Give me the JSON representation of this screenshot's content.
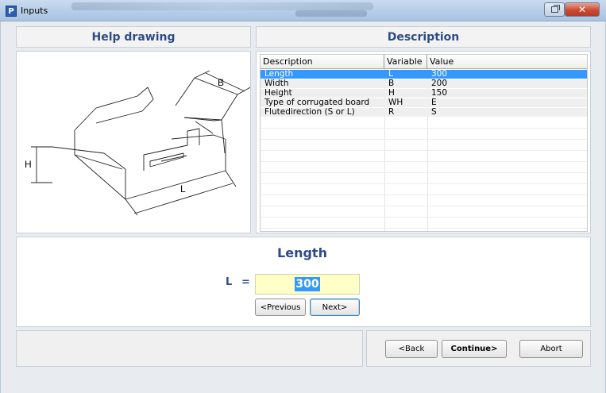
{
  "window": {
    "title": "Inputs",
    "app_icon_letter": "P"
  },
  "headers": {
    "help_drawing": "Help drawing",
    "description": "Description"
  },
  "drawing": {
    "label_b": "B",
    "label_h": "H",
    "label_l": "L"
  },
  "table": {
    "columns": [
      "Description",
      "Variable",
      "Value"
    ],
    "rows": [
      {
        "description": "Length",
        "variable": "L",
        "value": "300"
      },
      {
        "description": "Width",
        "variable": "B",
        "value": "200"
      },
      {
        "description": "Height",
        "variable": "H",
        "value": "150"
      },
      {
        "description": "Type of corrugated board",
        "variable": "WH",
        "value": "E"
      },
      {
        "description": "Flutedirection (S or L)",
        "variable": "R",
        "value": "S"
      }
    ],
    "selected_index": 0
  },
  "input": {
    "title": "Length",
    "variable": "L",
    "equals": "=",
    "value": "300",
    "previous_label": "<Previous",
    "next_label": "Next>"
  },
  "footer": {
    "back_label": "<Back",
    "continue_label": "Continue>",
    "abort_label": "Abort"
  },
  "colors": {
    "header_text": "#2d4b87",
    "selection": "#3399ff",
    "input_background": "#ffffc8"
  }
}
